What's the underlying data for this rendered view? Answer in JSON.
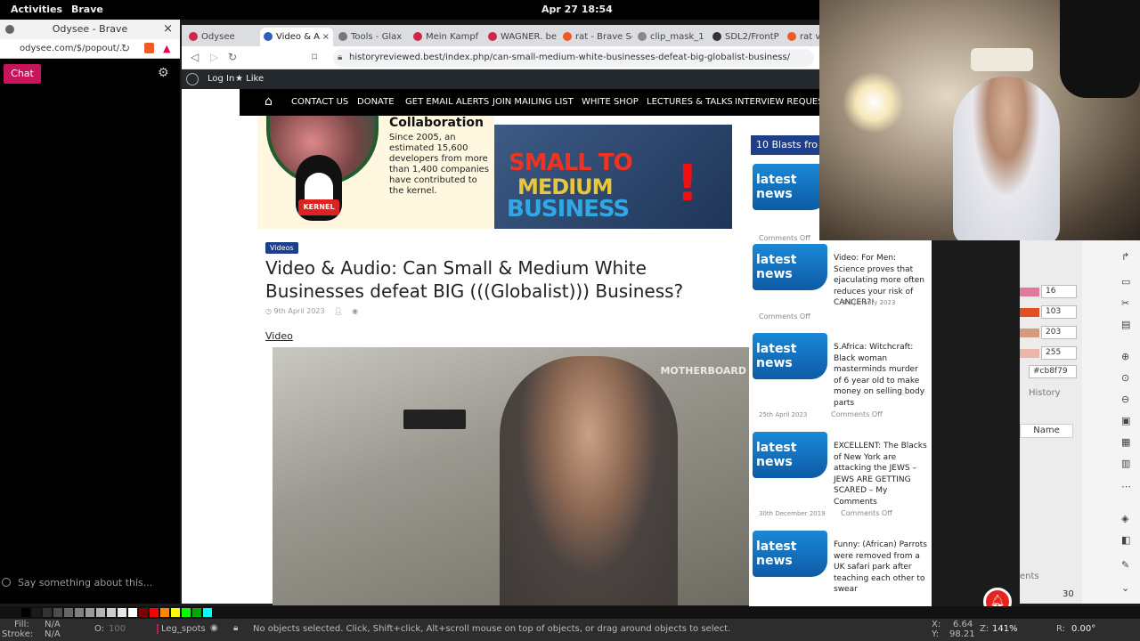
{
  "system": {
    "activities": "Activities",
    "app": "Brave",
    "clock": "Apr 27  18:54"
  },
  "popout": {
    "title": "Odysee - Brave",
    "url": "odysee.com/$/popout/...",
    "chat_button": "Chat",
    "say_placeholder": "Say something about this..."
  },
  "browser": {
    "tabs": [
      {
        "label": "Odysee",
        "color": "#d2254c"
      },
      {
        "label": "Video & A",
        "color": "#2d5fbf"
      },
      {
        "label": "Tools - Glax",
        "color": "#777"
      },
      {
        "label": "Mein Kampf",
        "color": "#d2254c"
      },
      {
        "label": "WAGNER. be",
        "color": "#d2254c"
      },
      {
        "label": "rat - Brave Se",
        "color": "#f15a24"
      },
      {
        "label": "clip_mask_1",
        "color": "#888"
      },
      {
        "label": "SDL2/FrontP",
        "color": "#333"
      },
      {
        "label": "rat v",
        "color": "#f15a24"
      }
    ],
    "url": "historyreviewed.best/index.php/can-small-medium-white-businesses-defeat-big-globalist-business/"
  },
  "wpbar": {
    "login": "Log In",
    "like": "Like"
  },
  "menu": {
    "items": [
      "CONTACT US",
      "DONATE",
      "GET EMAIL ALERTS",
      "JOIN MAILING LIST",
      "WHITE SHOP",
      "LECTURES & TALKS",
      "INTERVIEW REQUEST"
    ]
  },
  "banner": {
    "collab_title": "Collaboration",
    "collab_text": "Since 2005, an estimated 15,600 developers from more than 1,400 companies have contributed to the kernel.",
    "kernel_label": "KERNEL",
    "line1": "SMALL TO",
    "line2": "MEDIUM",
    "line3": "BUSINESS",
    "exclaim": "!"
  },
  "article": {
    "badge": "Videos",
    "title": "Video & Audio: Can Small & Medium White Businesses defeat BIG (((Globalist))) Business?",
    "date": "9th April 2023",
    "video_label": "Video",
    "watermark": "MOTHERBOARD"
  },
  "sidebar": {
    "heading": "10 Blasts fro",
    "badge_text": "latest news",
    "first_comments": "Comments Off",
    "items": [
      {
        "title": "Video: For Men: Science proves that ejaculating more often reduces your risk of CANCER?!",
        "date": "3rd January 2023",
        "comments": "Comments Off"
      },
      {
        "title": "S.Africa: Witchcraft: Black woman masterminds murder of 6 year old to make money on selling body parts",
        "date": "25th April 2023",
        "comments": "Comments Off"
      },
      {
        "title": "EXCELLENT: The Blacks of New York are attacking the JEWS – JEWS ARE GETTING SCARED – My Comments",
        "date": "30th December 2019",
        "comments": "Comments Off"
      },
      {
        "title": "Funny: (African) Parrots were removed from a UK safari park after teaching each other to swear",
        "date": "",
        "comments": ""
      }
    ]
  },
  "inkscape": {
    "fields": [
      "16",
      "103",
      "203",
      "255"
    ],
    "hex": "#cb8f79",
    "history": "History",
    "name_header": "Name",
    "ents": "ents",
    "thirty": "30"
  },
  "status": {
    "fill_label": "Fill:",
    "fill_value": "N/A",
    "stroke_label": "Stroke:",
    "stroke_value": "N/A",
    "opacity_label": "O:",
    "opacity_value": "100",
    "layer": "Leg_spots",
    "message": "No objects selected. Click, Shift+click, Alt+scroll mouse on top of objects, or drag around objects to select.",
    "x_label": "X:",
    "x_value": "6.64",
    "y_label": "Y:",
    "y_value": "98.21",
    "zoom_label": "Z:",
    "zoom_value": "141%",
    "rot_label": "R:",
    "rot_value": "0.00°"
  },
  "colors": {
    "accent_pink": "#c6155b",
    "wp_blue": "#1e3f8a",
    "news_blue": "#1a88d6"
  }
}
